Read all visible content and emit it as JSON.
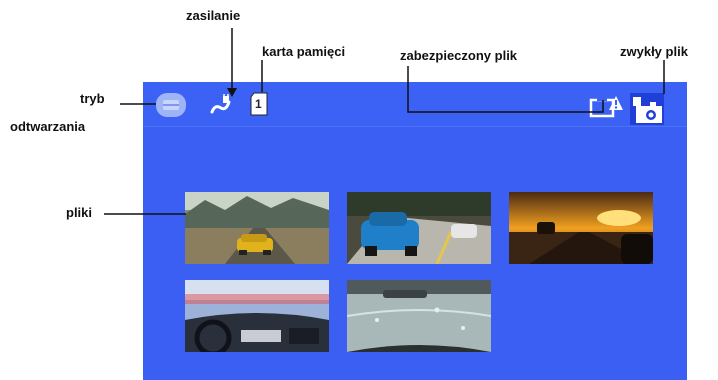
{
  "callouts": {
    "playback_mode_line1": "tryb",
    "playback_mode_line2": "odtwarzania",
    "power": "zasilanie",
    "memory_card": "karta pamięci",
    "protected_file": "zabezpieczony plik",
    "normal_file": "zwykły plik",
    "files": "pliki"
  },
  "screen": {
    "background": "#3a5ff2",
    "memory_card_number": "1",
    "icons": [
      "playback-mode-icon",
      "power-icon",
      "memory-card-icon",
      "protected-file-icon",
      "normal-file-icon"
    ],
    "thumbnails": [
      {
        "name": "thumb-yellow-car-desert"
      },
      {
        "name": "thumb-blue-car-road"
      },
      {
        "name": "thumb-sunset-road"
      },
      {
        "name": "thumb-dashboard-view"
      },
      {
        "name": "thumb-wet-windshield"
      }
    ]
  }
}
